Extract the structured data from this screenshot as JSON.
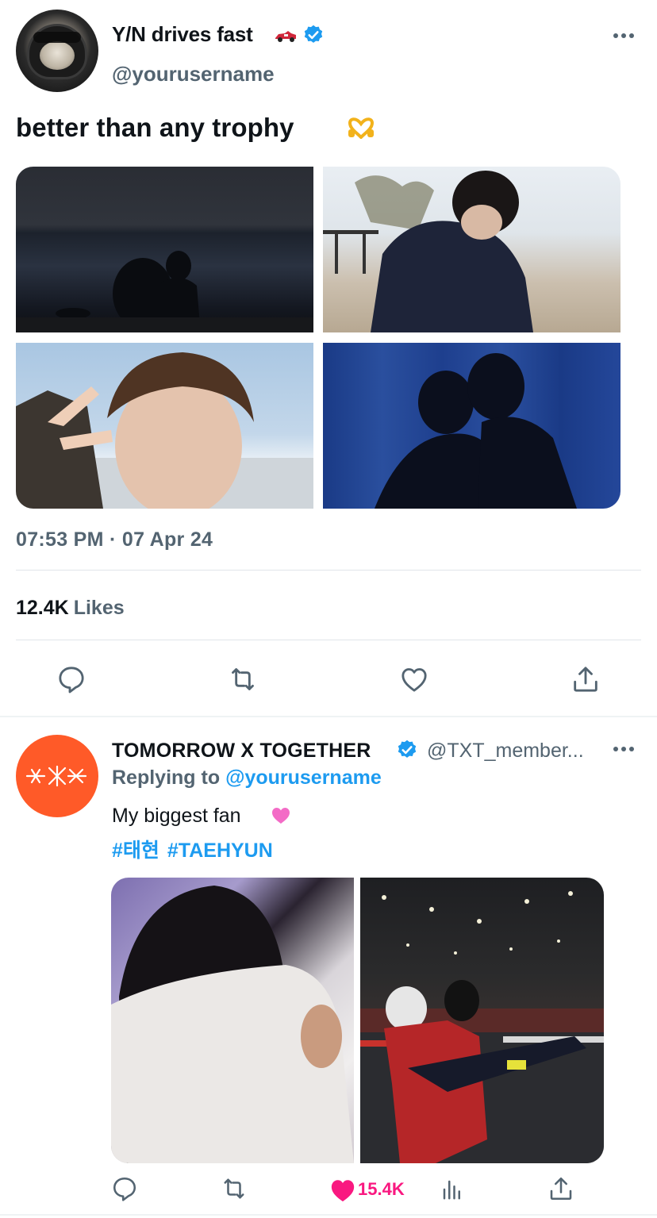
{
  "tweet1": {
    "display_name": "Y/N drives fast",
    "name_emoji": "race-car-emoji",
    "handle": "@yourusername",
    "text": "better than any trophy",
    "text_emoji": "heart-hands-emoji",
    "timestamp": "07:53 PM · 07 Apr 24",
    "likes_count": "12.4K",
    "likes_label": "Likes"
  },
  "tweet2": {
    "display_name": "TOMORROW X TOGETHER",
    "handle": "@TXT_member...",
    "replying_prefix": "Replying to",
    "replying_mention": "@yourusername",
    "text": "My biggest fan",
    "text_emoji": "pink-heart-emoji",
    "hashtags": [
      "#태현",
      "#TAEHYUN"
    ],
    "like_count": "15.4K"
  },
  "colors": {
    "text_primary": "#0f1419",
    "text_secondary": "#536471",
    "link_blue": "#1d9bf0",
    "like_pink": "#f91880",
    "verified_blue": "#1d9bf0",
    "txt_orange": "#ff5a28"
  }
}
